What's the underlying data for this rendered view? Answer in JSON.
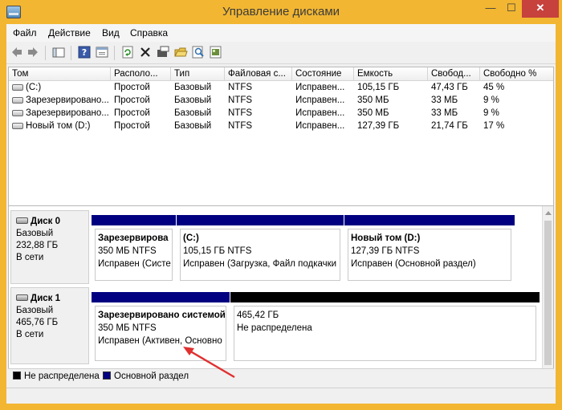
{
  "window": {
    "title": "Управление дисками",
    "minimize_glyph": "—",
    "maximize_glyph": "☐",
    "close_glyph": "✕"
  },
  "menu": [
    "Файл",
    "Действие",
    "Вид",
    "Справка"
  ],
  "toolbar": {
    "icons": [
      "back-icon",
      "forward-icon",
      "console-tree-icon",
      "help-icon",
      "properties-icon",
      "refresh-icon",
      "delete-icon",
      "disk-settings-icon",
      "open-folder-icon",
      "search-icon",
      "export-icon"
    ]
  },
  "volume_list": {
    "columns": [
      "Том",
      "Располо...",
      "Тип",
      "Файловая с...",
      "Состояние",
      "Емкость",
      "Свобод...",
      "Свободно %"
    ],
    "rows": [
      [
        "(C:)",
        "Простой",
        "Базовый",
        "NTFS",
        "Исправен...",
        "105,15 ГБ",
        "47,43 ГБ",
        "45 %"
      ],
      [
        "Зарезервировано...",
        "Простой",
        "Базовый",
        "NTFS",
        "Исправен...",
        "350 МБ",
        "33 МБ",
        "9 %"
      ],
      [
        "Зарезервировано...",
        "Простой",
        "Базовый",
        "NTFS",
        "Исправен...",
        "350 МБ",
        "33 МБ",
        "9 %"
      ],
      [
        "Новый том (D:)",
        "Простой",
        "Базовый",
        "NTFS",
        "Исправен...",
        "127,39 ГБ",
        "21,74 ГБ",
        "17 %"
      ]
    ]
  },
  "disks": [
    {
      "name": "Диск 0",
      "type": "Базовый",
      "size": "232,88 ГБ",
      "status": "В сети",
      "partitions": [
        {
          "name": "Зарезервирова",
          "size": "350 МБ NTFS",
          "status": "Исправен (Систе",
          "bar_color": "#000080"
        },
        {
          "name": "(C:)",
          "size": "105,15 ГБ NTFS",
          "status": "Исправен (Загрузка, Файл подкачки",
          "bar_color": "#000080"
        },
        {
          "name": "Новый том  (D:)",
          "size": "127,39 ГБ NTFS",
          "status": "Исправен (Основной раздел)",
          "bar_color": "#000080"
        }
      ]
    },
    {
      "name": "Диск 1",
      "type": "Базовый",
      "size": "465,76 ГБ",
      "status": "В сети",
      "partitions": [
        {
          "name": "Зарезервировано системой",
          "size": "350 МБ NTFS",
          "status": "Исправен (Активен, Основно",
          "bar_color": "#000080"
        },
        {
          "name": "",
          "size": "465,42 ГБ",
          "status": "Не распределена",
          "bar_color": "#000000"
        }
      ]
    }
  ],
  "legend": [
    {
      "label": "Не распределена",
      "color": "#000000"
    },
    {
      "label": "Основной раздел",
      "color": "#000080"
    }
  ],
  "colors": {
    "title_bar": "#f2b632",
    "close_button": "#c7413d",
    "annotation_arrow": "#e03030"
  }
}
